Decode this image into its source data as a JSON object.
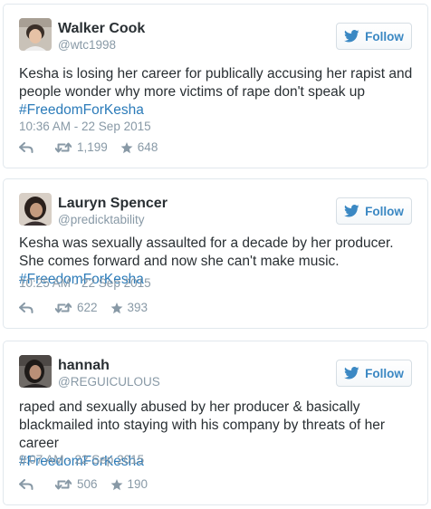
{
  "tweets": [
    {
      "name": "Walker Cook",
      "handle": "@wtc1998",
      "follow_label": "Follow",
      "text": "Kesha is losing her career for publically accusing her rapist and people wonder why more victims of rape don't speak up",
      "hashtag": "#FreedomForKesha",
      "timestamp": "10:36 AM - 22 Sep 2015",
      "retweets": "1,199",
      "favorites": "648"
    },
    {
      "name": "Lauryn Spencer",
      "handle": "@predicktability",
      "follow_label": "Follow",
      "text": "Kesha was sexually assaulted for a decade by her producer. She comes forward and now she can't make music.",
      "hashtag": "#FreedomForKesha",
      "timestamp": "10:25 AM - 22 Sep 2015",
      "retweets": "622",
      "favorites": "393"
    },
    {
      "name": "hannah",
      "handle": "@REGUICULOUS",
      "follow_label": "Follow",
      "text": "raped and sexually abused by her producer & basically blackmailed into staying with his company by threats of her career",
      "hashtag": "#FreedomForKesha",
      "timestamp": "9:07 AM - 22 Sep 2015",
      "retweets": "506",
      "favorites": "190"
    }
  ],
  "colors": {
    "link": "#2b7bb9",
    "follow": "#3b88c3",
    "muted": "#8899a6",
    "text": "#292f33",
    "border": "#e1e8ed"
  },
  "icons": {
    "follow": "twitter-bird-icon",
    "reply": "reply-icon",
    "retweet": "retweet-icon",
    "favorite": "star-icon"
  }
}
